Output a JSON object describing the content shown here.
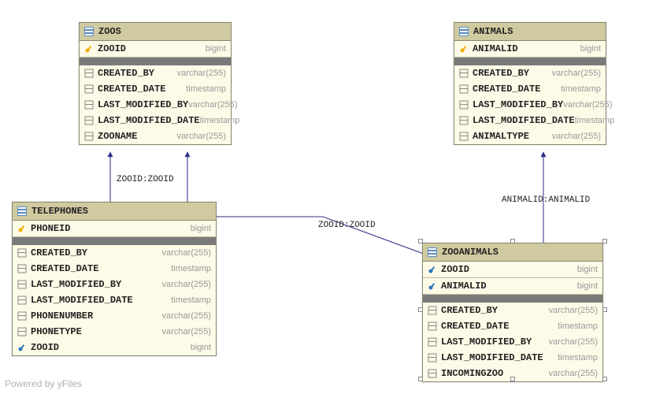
{
  "footer": "Powered by yFiles",
  "types": {
    "bigint": "bigint",
    "varchar": "varchar(255)",
    "timestamp": "timestamp"
  },
  "edges": {
    "telephones_zoos": "ZOOID:ZOOID",
    "zooanimals_zoos": "ZOOID:ZOOID",
    "zooanimals_animals": "ANIMALID:ANIMALID"
  },
  "entities": {
    "zoos": {
      "name": "ZOOS",
      "pks": [
        {
          "name": "ZOOID",
          "type": "bigint"
        }
      ],
      "cols": [
        {
          "name": "CREATED_BY",
          "type": "varchar"
        },
        {
          "name": "CREATED_DATE",
          "type": "timestamp"
        },
        {
          "name": "LAST_MODIFIED_BY",
          "type": "varchar"
        },
        {
          "name": "LAST_MODIFIED_DATE",
          "type": "timestamp"
        },
        {
          "name": "ZOONAME",
          "type": "varchar"
        }
      ]
    },
    "animals": {
      "name": "ANIMALS",
      "pks": [
        {
          "name": "ANIMALID",
          "type": "bigint"
        }
      ],
      "cols": [
        {
          "name": "CREATED_BY",
          "type": "varchar"
        },
        {
          "name": "CREATED_DATE",
          "type": "timestamp"
        },
        {
          "name": "LAST_MODIFIED_BY",
          "type": "varchar"
        },
        {
          "name": "LAST_MODIFIED_DATE",
          "type": "timestamp"
        },
        {
          "name": "ANIMALTYPE",
          "type": "varchar"
        }
      ]
    },
    "telephones": {
      "name": "TELEPHONES",
      "pks": [
        {
          "name": "PHONEID",
          "type": "bigint"
        }
      ],
      "cols": [
        {
          "name": "CREATED_BY",
          "type": "varchar"
        },
        {
          "name": "CREATED_DATE",
          "type": "timestamp"
        },
        {
          "name": "LAST_MODIFIED_BY",
          "type": "varchar"
        },
        {
          "name": "LAST_MODIFIED_DATE",
          "type": "timestamp"
        },
        {
          "name": "PHONENUMBER",
          "type": "varchar"
        },
        {
          "name": "PHONETYPE",
          "type": "varchar"
        },
        {
          "name": "ZOOID",
          "type": "bigint"
        }
      ]
    },
    "zooanimals": {
      "name": "ZOOANIMALS",
      "pks": [
        {
          "name": "ZOOID",
          "type": "bigint"
        },
        {
          "name": "ANIMALID",
          "type": "bigint"
        }
      ],
      "cols": [
        {
          "name": "CREATED_BY",
          "type": "varchar"
        },
        {
          "name": "CREATED_DATE",
          "type": "timestamp"
        },
        {
          "name": "LAST_MODIFIED_BY",
          "type": "varchar"
        },
        {
          "name": "LAST_MODIFIED_DATE",
          "type": "timestamp"
        },
        {
          "name": "INCOMINGZOO",
          "type": "varchar"
        }
      ]
    }
  }
}
